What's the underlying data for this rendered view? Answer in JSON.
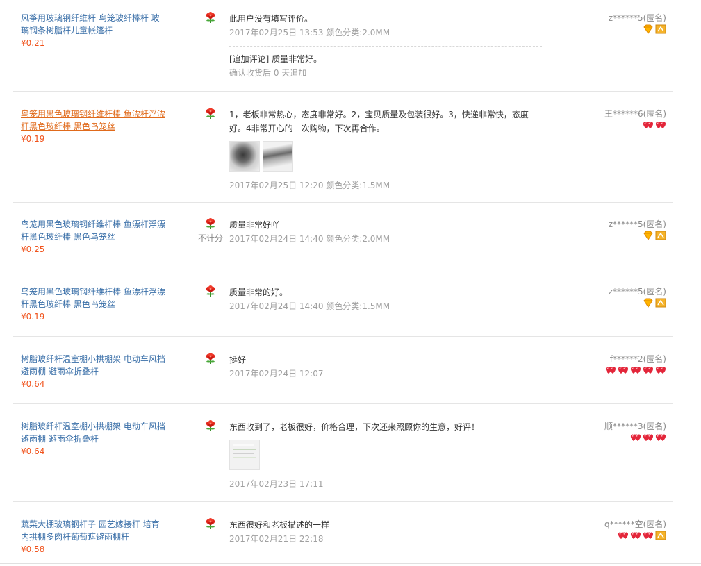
{
  "reviews": [
    {
      "product": "风筝用玻璃钢纤维杆 鸟笼玻纤棒杆 玻璃钢条树脂杆儿童帐篷杆",
      "price": "¥0.21",
      "comment": "此用户没有填写评价。",
      "meta": "2017年02月25日 13:53 颜色分类:2.0MM",
      "append_comment": "[追加评论] 质量非常好。",
      "append_meta": "确认收货后 0 天追加",
      "user": "z******5(匿名)",
      "badges": [
        "diamond",
        "vip"
      ]
    },
    {
      "product": "鸟笼用黑色玻璃钢纤维杆棒 鱼漂杆浮漂杆黑色玻纤棒 黑色鸟笼丝",
      "price": "¥0.19",
      "comment": "1，老板非常热心，态度非常好。2，宝贝质量及包装很好。3，快递非常快，态度好。4非常开心的一次购物，下次再合作。",
      "meta": "2017年02月25日 12:20 颜色分类:1.5MM",
      "user": "王******6(匿名)",
      "badges": [
        "heart",
        "heart"
      ],
      "thumbs": [
        "fishing-rod-photo-1",
        "fishing-rod-photo-2"
      ]
    },
    {
      "product": "鸟笼用黑色玻璃钢纤维杆棒 鱼漂杆浮漂杆黑色玻纤棒 黑色鸟笼丝",
      "price": "¥0.25",
      "comment": "质量非常好吖",
      "meta": "2017年02月24日 14:40 颜色分类:2.0MM",
      "user": "z******5(匿名)",
      "badges": [
        "diamond",
        "vip"
      ],
      "not_counted": "不计分"
    },
    {
      "product": "鸟笼用黑色玻璃钢纤维杆棒 鱼漂杆浮漂杆黑色玻纤棒 黑色鸟笼丝",
      "price": "¥0.19",
      "comment": "质量非常的好。",
      "meta": "2017年02月24日 14:40 颜色分类:1.5MM",
      "user": "z******5(匿名)",
      "badges": [
        "diamond",
        "vip"
      ]
    },
    {
      "product": "树脂玻纤杆温室棚小拱棚架 电动车风挡 避雨棚 避雨伞折叠杆",
      "price": "¥0.64",
      "comment": "挺好",
      "meta": "2017年02月24日 12:07",
      "user": "f******2(匿名)",
      "badges": [
        "heart",
        "heart",
        "heart",
        "heart",
        "heart"
      ]
    },
    {
      "product": "树脂玻纤杆温室棚小拱棚架 电动车风挡 避雨棚 避雨伞折叠杆",
      "price": "¥0.64",
      "comment": "东西收到了，老板很好，价格合理，下次还来照顾你的生意，好评！",
      "meta": "2017年02月23日 17:11",
      "user": "顺******3(匿名)",
      "badges": [
        "heart",
        "heart",
        "heart"
      ],
      "thumbs": [
        "screenshot-photo"
      ]
    },
    {
      "product": "蔬菜大棚玻璃钢杆子 园艺嫁接杆 培育内拱棚多肉杆葡萄遮避雨棚杆",
      "price": "¥0.58",
      "comment": "东西很好和老板描述的一样",
      "meta": "2017年02月21日 22:18",
      "user": "q******空(匿名)",
      "badges": [
        "heart",
        "heart",
        "heart",
        "vip"
      ]
    }
  ]
}
